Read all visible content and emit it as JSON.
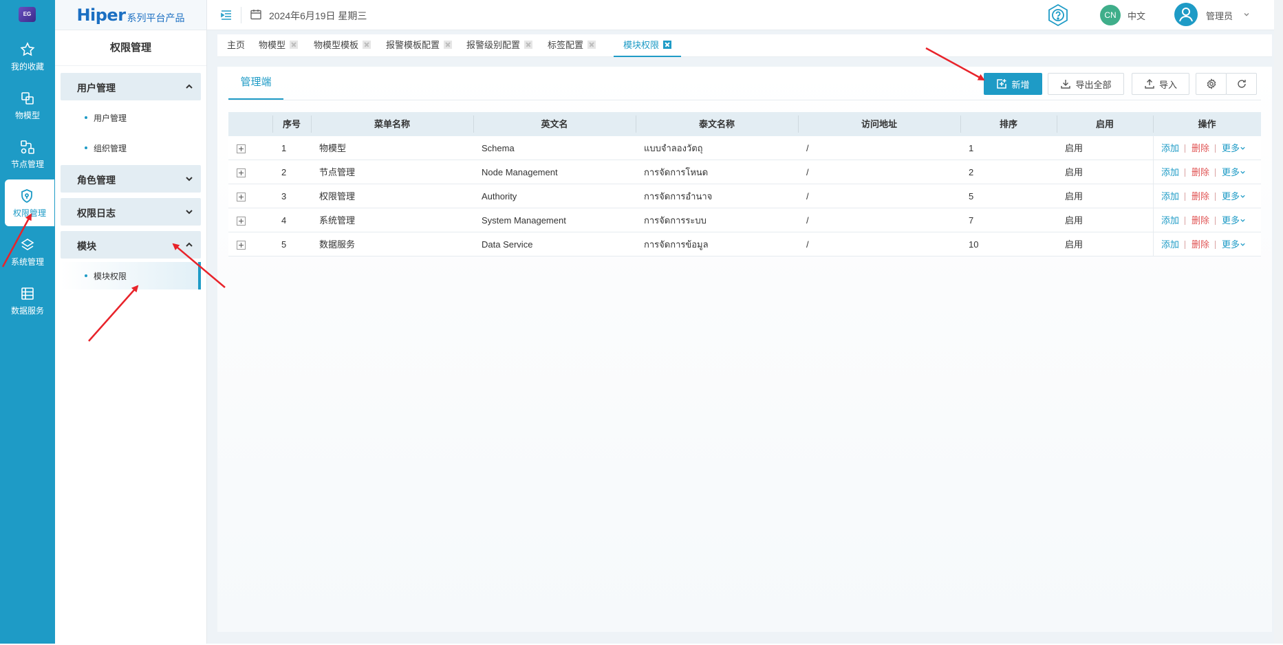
{
  "rail": {
    "logo_text": "EG",
    "items": [
      {
        "label": "我的收藏",
        "icon": "star-icon"
      },
      {
        "label": "物模型",
        "icon": "model-icon"
      },
      {
        "label": "节点管理",
        "icon": "node-icon"
      },
      {
        "label": "权限管理",
        "icon": "shield-icon"
      },
      {
        "label": "系统管理",
        "icon": "system-icon"
      },
      {
        "label": "数据服务",
        "icon": "data-icon"
      }
    ]
  },
  "sidebar": {
    "brand_main": "Hiper",
    "brand_sub": "系列平台产品",
    "title": "权限管理",
    "groups": [
      {
        "label": "用户管理",
        "expanded": true,
        "items": [
          "用户管理",
          "组织管理"
        ]
      },
      {
        "label": "角色管理",
        "expanded": false
      },
      {
        "label": "权限日志",
        "expanded": false
      },
      {
        "label": "模块",
        "expanded": true,
        "items": [
          "模块权限"
        ]
      }
    ]
  },
  "header": {
    "date": "2024年6月19日 星期三",
    "lang_badge": "CN",
    "lang": "中文",
    "user": "管理员"
  },
  "tabs": [
    "主页",
    "物模型",
    "物模型模板",
    "报警模板配置",
    "报警级别配置",
    "标签配置",
    "模块权限"
  ],
  "active_tab": "模块权限",
  "panel": {
    "sub_tab": "管理端",
    "buttons": {
      "add": "新增",
      "export": "导出全部",
      "import": "导入"
    }
  },
  "table": {
    "headers": [
      "序号",
      "菜单名称",
      "英文名",
      "泰文名称",
      "访问地址",
      "排序",
      "启用",
      "操作"
    ],
    "rows": [
      {
        "no": "1",
        "name": "物模型",
        "en": "Schema",
        "th": "แบบจำลองวัตถุ",
        "url": "/",
        "sort": "1",
        "enabled": "启用"
      },
      {
        "no": "2",
        "name": "节点管理",
        "en": "Node Management",
        "th": "การจัดการโหนด",
        "url": "/",
        "sort": "2",
        "enabled": "启用"
      },
      {
        "no": "3",
        "name": "权限管理",
        "en": "Authority",
        "th": "การจัดการอำนาจ",
        "url": "/",
        "sort": "5",
        "enabled": "启用"
      },
      {
        "no": "4",
        "name": "系统管理",
        "en": "System Management",
        "th": "การจัดการระบบ",
        "url": "/",
        "sort": "7",
        "enabled": "启用"
      },
      {
        "no": "5",
        "name": "数据服务",
        "en": "Data Service",
        "th": "การจัดการข้อมูล",
        "url": "/",
        "sort": "10",
        "enabled": "启用"
      }
    ],
    "actions": {
      "add": "添加",
      "delete": "删除",
      "more": "更多"
    }
  },
  "colors": {
    "accent": "#1e9bc6",
    "danger": "#e05555",
    "annotation": "#e8232a"
  }
}
